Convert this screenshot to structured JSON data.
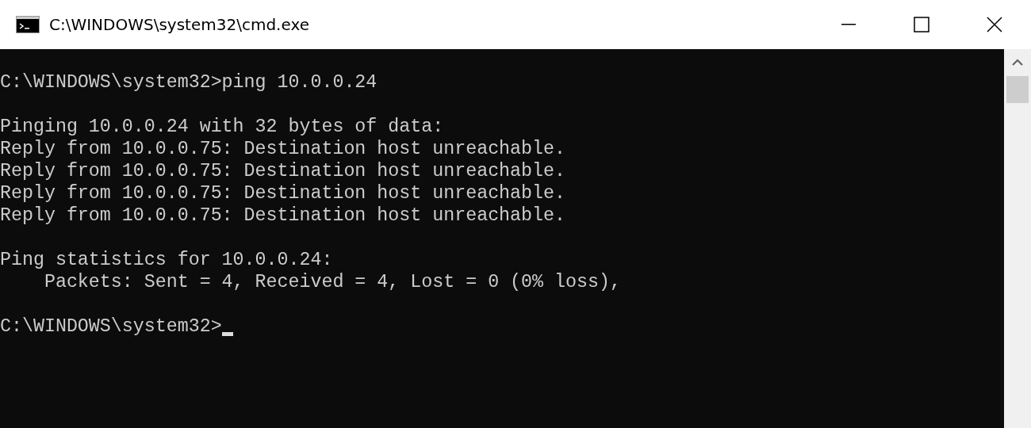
{
  "window": {
    "title": "C:\\WINDOWS\\system32\\cmd.exe"
  },
  "console": {
    "blocks": [
      [
        "C:\\WINDOWS\\system32>ping 10.0.0.24"
      ],
      [
        "Pinging 10.0.0.24 with 32 bytes of data:",
        "Reply from 10.0.0.75: Destination host unreachable.",
        "Reply from 10.0.0.75: Destination host unreachable.",
        "Reply from 10.0.0.75: Destination host unreachable.",
        "Reply from 10.0.0.75: Destination host unreachable."
      ],
      [
        "Ping statistics for 10.0.0.24:",
        "    Packets: Sent = 4, Received = 4, Lost = 0 (0% loss),"
      ],
      [
        "C:\\WINDOWS\\system32>"
      ]
    ],
    "cursor_visible": true
  }
}
